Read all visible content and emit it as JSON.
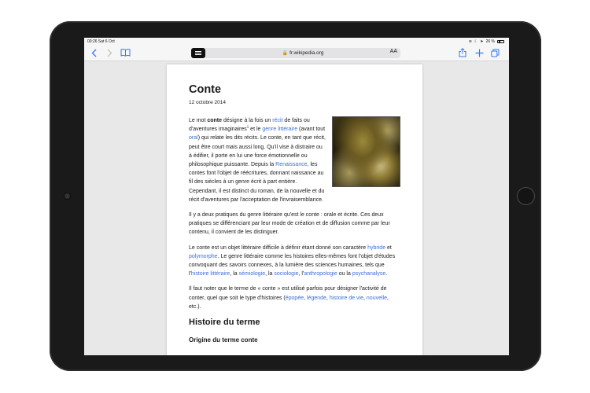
{
  "status_bar": {
    "time": "00:26",
    "date": "Sat 6 Oct",
    "battery": "26 %"
  },
  "toolbar": {
    "back_icon": "chevron-left-icon",
    "forward_icon": "chevron-right-icon",
    "bookmarks_icon": "book-icon",
    "reader_icon": "reader-view-icon",
    "lock_icon": "lock-icon",
    "url": "fr.wikipedia.org",
    "text_size_label": "AA",
    "share_icon": "share-icon",
    "add_icon": "plus-icon",
    "tabs_icon": "tabs-icon"
  },
  "article": {
    "title": "Conte",
    "date": "12 octobre 2014",
    "p1": {
      "t1": "Le mot ",
      "b1": "conte",
      "t2": " désigne à la fois un ",
      "l1": "récit",
      "t3": " de faits ou d'aventures imaginaires",
      "sup": "1",
      "t4": " et le ",
      "l2": "genre littéraire",
      "t5": " (avant tout ",
      "l3": "oral",
      "t6": ") qui relate les dits récits. Le conte, en tant que récit, peut être court mais aussi long. Qu'il vise à distraire ou à édifier, il porte en lui une force émotionnelle ou philosophique puissante. Depuis la ",
      "l4": "Renaissance",
      "t7": ", les contes font l'objet de réécritures, donnant naissance au fil des siècles à un genre écrit à part entière. Cependant, il est distinct du roman, de la nouvelle et du récit d'aventures par l'acceptation de l'invraisemblance."
    },
    "p2": "Il y a deux pratiques du genre littéraire qu'est le conte : orale et écrite. Ces deux pratiques se différenciant par leur mode de création et de diffusion comme par leur contenu, il convient de les distinguer.",
    "p3": {
      "t1": "Le conte est un objet littéraire difficile à définir étant donné son caractère ",
      "l1": "hybride",
      "t2": " et ",
      "l2": "polymorphe",
      "t3": ". Le genre littéraire comme les histoires elles-mêmes font l'objet d'études convoquant des savoirs connexes, à la lumière des sciences humaines, tels que l'",
      "l3": "histoire littéraire",
      "t4": ", la ",
      "l4": "sémiologie",
      "t5": ", la ",
      "l5": "sociologie",
      "t6": ", l'",
      "l6": "anthropologie",
      "t7": " ou la ",
      "l7": "psychanalyse",
      "t8": "."
    },
    "p4": {
      "t1": "Il faut noter que le terme de « conte » est utilisé parfois pour désigner l'activité de conter, quel que soit le type d'histoires (",
      "l1": "épopée",
      "t2": ", ",
      "l2": "légende",
      "t3": ", ",
      "l3": "histoire de vie",
      "t4": ", ",
      "l4": "nouvelle",
      "t5": ", etc.)."
    },
    "section_title": "Histoire du terme",
    "subsection_title": "Origine du terme conte"
  },
  "colors": {
    "accent": "#3478f6",
    "link": "#3b6fd6",
    "text": "#1a1a1a",
    "background": "#e8e8e8"
  }
}
